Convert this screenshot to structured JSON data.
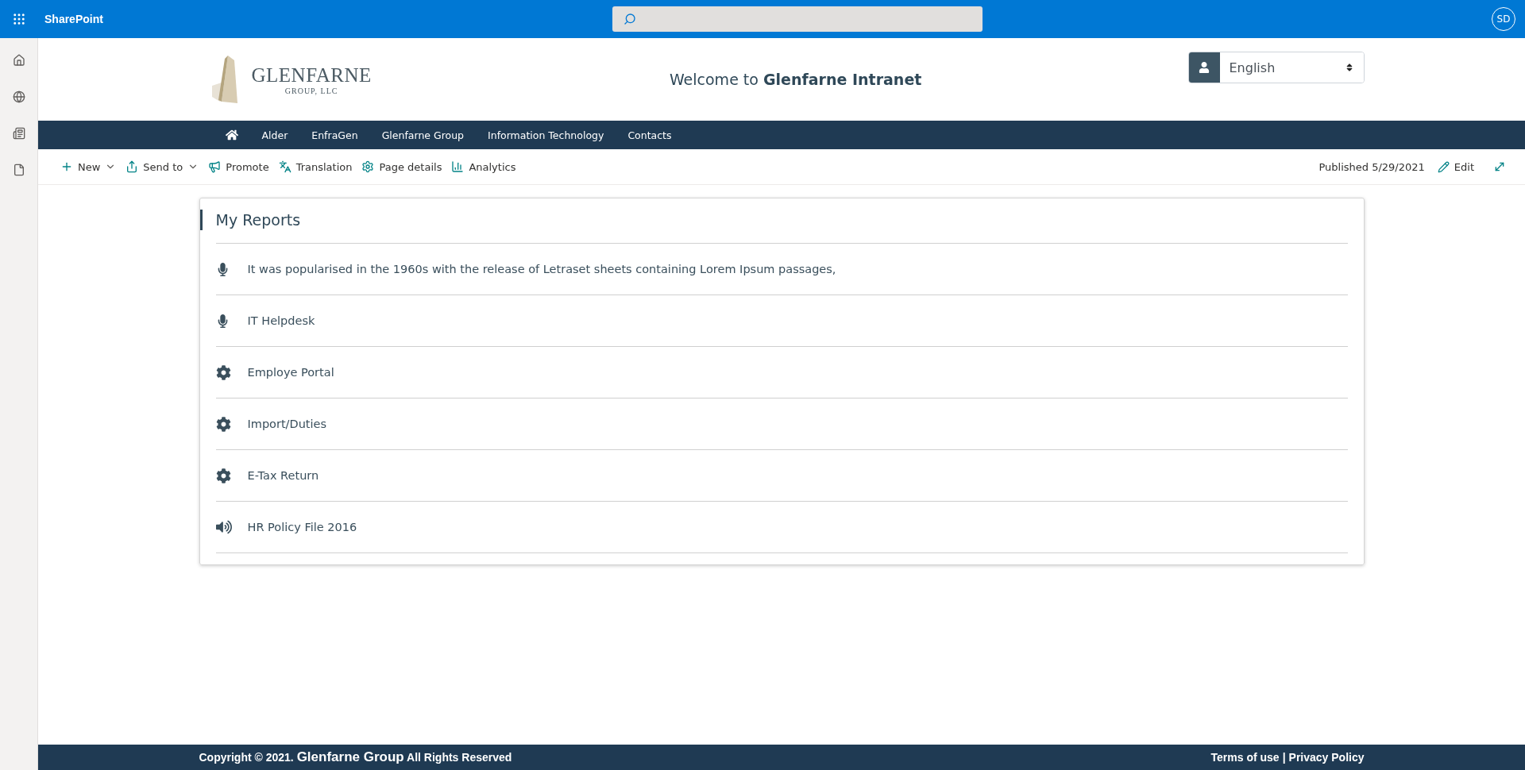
{
  "suite_bar": {
    "app_name": "SharePoint",
    "avatar": "SD"
  },
  "header": {
    "logo_name": "GLENFARNE",
    "logo_sub": "GROUP, LLC",
    "welcome": "Welcome to **Glenfarne Intranet**",
    "language": "English"
  },
  "nav": {
    "items": [
      {
        "label": "Alder"
      },
      {
        "label": "EnfraGen"
      },
      {
        "label": "Glenfarne Group"
      },
      {
        "label": "Information Technology"
      },
      {
        "label": "Contacts"
      }
    ]
  },
  "command_bar": {
    "items": [
      {
        "kind": "new",
        "label": "New",
        "dropdown": true
      },
      {
        "kind": "send",
        "label": "Send to",
        "dropdown": true
      },
      {
        "kind": "promote",
        "label": "Promote",
        "dropdown": false
      },
      {
        "kind": "translate",
        "label": "Translation",
        "dropdown": false
      },
      {
        "kind": "details",
        "label": "Page details",
        "dropdown": false
      },
      {
        "kind": "analytics",
        "label": "Analytics",
        "dropdown": false
      }
    ],
    "published": "Published 5/29/2021",
    "edit": "Edit"
  },
  "reports": {
    "title": "My Reports",
    "items": [
      {
        "kind": "mic",
        "label": "It was popularised in the 1960s with the release of Letraset sheets containing Lorem Ipsum passages,"
      },
      {
        "kind": "mic",
        "label": "IT Helpdesk"
      },
      {
        "kind": "gear",
        "label": "Employe Portal"
      },
      {
        "kind": "gear",
        "label": "Import/Duties"
      },
      {
        "kind": "gear",
        "label": "E-Tax Return"
      },
      {
        "kind": "speaker",
        "label": "HR Policy File 2016"
      }
    ]
  },
  "footer": {
    "copyright": "Copyright © 2021. **Glenfarne Group** All Rights Reserved",
    "terms": "Terms of use",
    "separator": "|",
    "privacy": "Privacy Policy"
  }
}
